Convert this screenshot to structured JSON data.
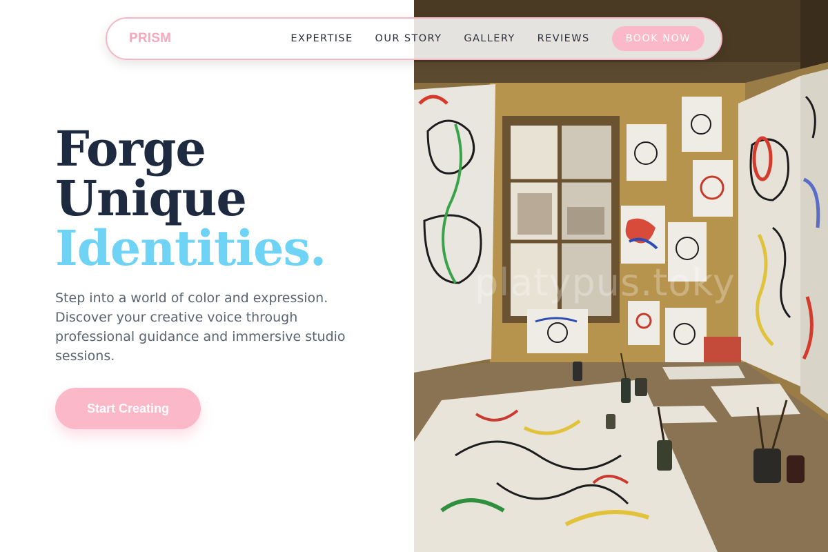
{
  "nav": {
    "brand": "PRISM",
    "links": [
      "EXPERTISE",
      "OUR STORY",
      "GALLERY",
      "REVIEWS"
    ],
    "cta": "BOOK NOW"
  },
  "hero": {
    "headline_line1": "Forge",
    "headline_line2": "Unique",
    "headline_accent": "Identities.",
    "description": "Step into a world of color and expression. Discover your creative voice through professional guidance and immersive studio sessions.",
    "cta": "Start Creating"
  },
  "image": {
    "watermark": "platypus.toky"
  },
  "colors": {
    "brand_pink": "#f6a9bd",
    "button_pink": "#fbb8c8",
    "accent_blue": "#6fd3f5",
    "headline_navy": "#1e2a40"
  }
}
